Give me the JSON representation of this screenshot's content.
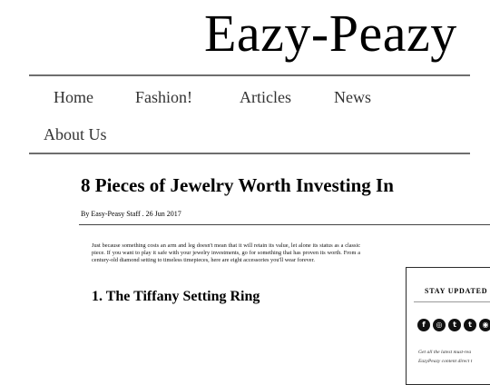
{
  "site": {
    "title": "Eazy-Peazy"
  },
  "nav": {
    "items": [
      {
        "label": "Home"
      },
      {
        "label": "Fashion!"
      },
      {
        "label": "Articles"
      },
      {
        "label": "News"
      },
      {
        "label": "About Us"
      }
    ]
  },
  "article": {
    "title": "8 Pieces of Jewelry Worth Investing In",
    "byline_prefix": "By ",
    "author": "Easy-Peasy Staff",
    "byline_separator": " . ",
    "date": "26 Jun 2017",
    "intro": "Just because something costs an arm and leg doesn't mean that it will retain its value, let alone its status as a classic piece. If you want to play it safe with your jewelry investments, go for something that has proven its worth. From a century-old diamond setting to timeless timepieces, here are eight accessories you'll wear forever.",
    "section_heading": "1. The Tiffany Setting Ring"
  },
  "sidebar": {
    "heading": "STAY UPDATED",
    "social": [
      {
        "icon": "facebook-icon",
        "glyph": "f"
      },
      {
        "icon": "instagram-icon",
        "glyph": "◎"
      },
      {
        "icon": "twitter-icon",
        "glyph": "t"
      },
      {
        "icon": "tumblr-icon",
        "glyph": "t"
      },
      {
        "icon": "rss-icon",
        "glyph": "◉"
      }
    ],
    "blurb_line1": "Get all the latest must-rea",
    "blurb_line2": "EazyPeazy content direct t"
  }
}
